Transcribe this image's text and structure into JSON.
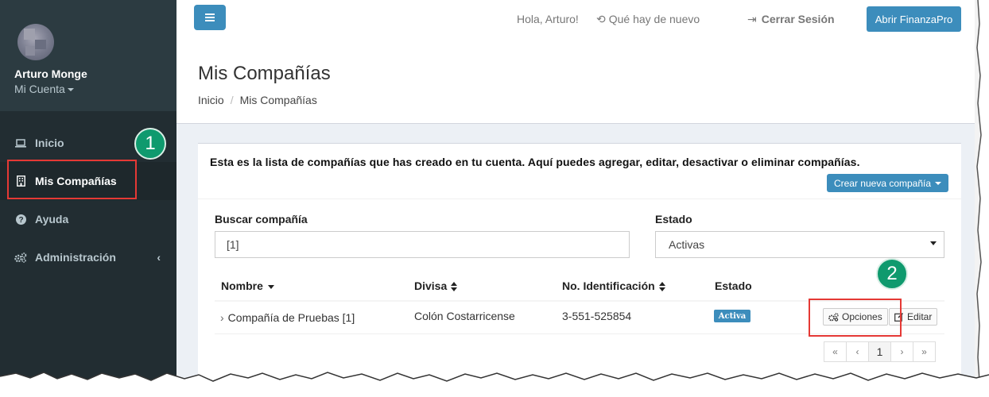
{
  "user": {
    "name": "Arturo Monge",
    "account": "Mi Cuenta"
  },
  "sidebar": {
    "items": [
      {
        "label": "Inicio",
        "icon": "laptop-icon"
      },
      {
        "label": "Mis Compañías",
        "icon": "building-icon"
      },
      {
        "label": "Ayuda",
        "icon": "question-icon"
      },
      {
        "label": "Administración",
        "icon": "gears-icon"
      }
    ]
  },
  "header": {
    "greeting": "Hola, Arturo!",
    "whats_new": "Qué hay de nuevo",
    "logout": "Cerrar Sesión",
    "open_app": "Abrir FinanzaPro"
  },
  "page": {
    "title": "Mis Compañías",
    "breadcrumb": [
      "Inicio",
      "Mis Compañías"
    ]
  },
  "box": {
    "description": "Esta es la lista de compañías que has creado en tu cuenta. Aquí puedes agregar, editar, desactivar o eliminar compañías.",
    "create_label": "Crear nueva compañía"
  },
  "filters": {
    "search_label": "Buscar compañía",
    "search_value": "[1]",
    "status_label": "Estado",
    "status_value": "Activas"
  },
  "table": {
    "columns": [
      "Nombre",
      "Divisa",
      "No. Identificación",
      "Estado"
    ],
    "rows": [
      {
        "name": "Compañía de Pruebas [1]",
        "currency": "Colón Costarricense",
        "id": "3-551-525854",
        "status": "Activa"
      }
    ],
    "actions": {
      "options": "Opciones",
      "edit": "Editar"
    }
  },
  "pagination": {
    "first": "«",
    "prev": "‹",
    "current": "1",
    "next": "›",
    "last": "»"
  },
  "annotations": {
    "step1": "1",
    "step2": "2"
  },
  "colors": {
    "sidebar_bg": "#222d32",
    "primary": "#3c8dbc",
    "callout_red": "#e53935",
    "badge_green": "#0f9a6e"
  }
}
